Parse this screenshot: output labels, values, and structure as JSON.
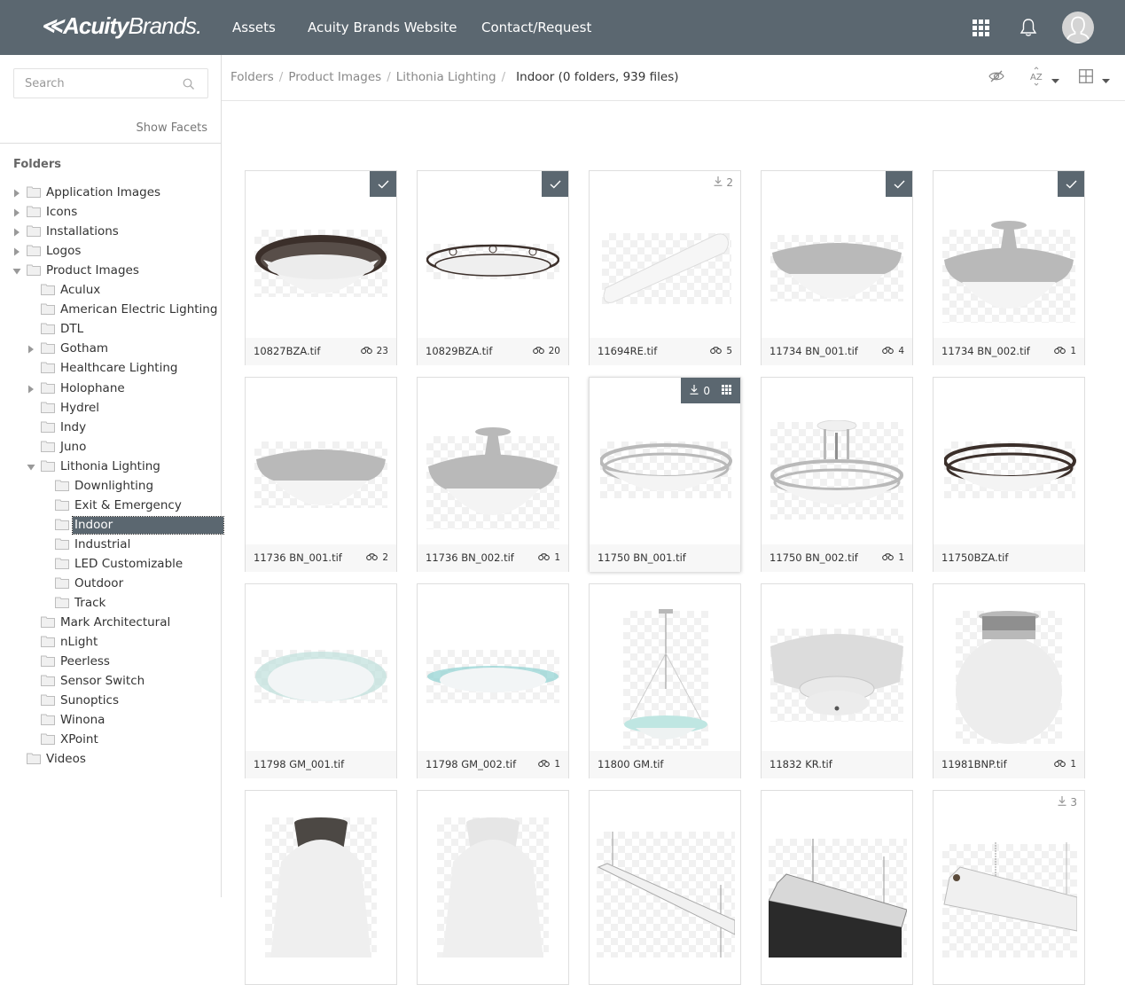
{
  "header": {
    "logo": {
      "mark": "≪",
      "acuity": "Acuity",
      "brands": "Brands."
    },
    "nav": [
      {
        "label": "Assets"
      },
      {
        "label": "Acuity Brands Website"
      },
      {
        "label": "Contact/Request"
      }
    ],
    "icons": [
      "apps-grid-icon",
      "bell-icon",
      "user-avatar-icon"
    ],
    "bg_color": "#5b6770"
  },
  "sidebar": {
    "search_placeholder": "Search",
    "show_facets": "Show Facets",
    "folders_title": "Folders",
    "tree": [
      {
        "label": "Application Images",
        "level": 0,
        "toggle": "collapsed"
      },
      {
        "label": "Icons",
        "level": 0,
        "toggle": "collapsed"
      },
      {
        "label": "Installations",
        "level": 0,
        "toggle": "collapsed"
      },
      {
        "label": "Logos",
        "level": 0,
        "toggle": "collapsed"
      },
      {
        "label": "Product Images",
        "level": 0,
        "toggle": "expanded"
      },
      {
        "label": "Aculux",
        "level": 1,
        "toggle": "none"
      },
      {
        "label": "American Electric Lighting",
        "level": 1,
        "toggle": "none"
      },
      {
        "label": "DTL",
        "level": 1,
        "toggle": "none"
      },
      {
        "label": "Gotham",
        "level": 1,
        "toggle": "collapsed"
      },
      {
        "label": "Healthcare Lighting",
        "level": 1,
        "toggle": "none"
      },
      {
        "label": "Holophane",
        "level": 1,
        "toggle": "collapsed"
      },
      {
        "label": "Hydrel",
        "level": 1,
        "toggle": "none"
      },
      {
        "label": "Indy",
        "level": 1,
        "toggle": "none"
      },
      {
        "label": "Juno",
        "level": 1,
        "toggle": "none"
      },
      {
        "label": "Lithonia Lighting",
        "level": 1,
        "toggle": "expanded"
      },
      {
        "label": "Downlighting",
        "level": 2,
        "toggle": "none"
      },
      {
        "label": "Exit & Emergency",
        "level": 2,
        "toggle": "none"
      },
      {
        "label": "Indoor",
        "level": 2,
        "toggle": "none",
        "selected": true
      },
      {
        "label": "Industrial",
        "level": 2,
        "toggle": "none"
      },
      {
        "label": "LED Customizable",
        "level": 2,
        "toggle": "none"
      },
      {
        "label": "Outdoor",
        "level": 2,
        "toggle": "none"
      },
      {
        "label": "Track",
        "level": 2,
        "toggle": "none"
      },
      {
        "label": "Mark Architectural",
        "level": 1,
        "toggle": "none"
      },
      {
        "label": "nLight",
        "level": 1,
        "toggle": "none"
      },
      {
        "label": "Peerless",
        "level": 1,
        "toggle": "none"
      },
      {
        "label": "Sensor Switch",
        "level": 1,
        "toggle": "none"
      },
      {
        "label": "Sunoptics",
        "level": 1,
        "toggle": "none"
      },
      {
        "label": "Winona",
        "level": 1,
        "toggle": "none"
      },
      {
        "label": "XPoint",
        "level": 1,
        "toggle": "none"
      },
      {
        "label": "Videos",
        "level": 0,
        "toggle": "none"
      }
    ]
  },
  "breadcrumb": {
    "items": [
      "Folders",
      "Product Images",
      "Lithonia Lighting"
    ],
    "separator": "/",
    "current": "Indoor (0 folders, 939 files)"
  },
  "toolbar": {
    "icons": [
      "hide-icon",
      "sort-az-icon",
      "grid-view-icon"
    ]
  },
  "assets": [
    {
      "name": "10827BZA.tif",
      "views": "23",
      "checked": true,
      "thumb": "bronze-scroll-dome"
    },
    {
      "name": "10829BZA.tif",
      "views": "20",
      "checked": true,
      "thumb": "bronze-scroll-flat"
    },
    {
      "name": "11694RE.tif",
      "views": "5",
      "downloads": "2",
      "thumb": "linear-wrap"
    },
    {
      "name": "11734 BN_001.tif",
      "views": "4",
      "checked": true,
      "thumb": "nickel-dome"
    },
    {
      "name": "11734 BN_002.tif",
      "views": "1",
      "checked": true,
      "thumb": "nickel-semi-flush"
    },
    {
      "name": "11736 BN_001.tif",
      "views": "2",
      "thumb": "nickel-dome-slim"
    },
    {
      "name": "11736 BN_002.tif",
      "views": "1",
      "thumb": "nickel-semi-flush"
    },
    {
      "name": "11750 BN_001.tif",
      "hover": true,
      "downloads": "0",
      "thumb": "nickel-band"
    },
    {
      "name": "11750 BN_002.tif",
      "views": "1",
      "thumb": "nickel-band-semi"
    },
    {
      "name": "11750BZA.tif",
      "thumb": "bronze-band"
    },
    {
      "name": "11798 GM_001.tif",
      "thumb": "glass-plate"
    },
    {
      "name": "11798 GM_002.tif",
      "views": "1",
      "thumb": "glass-plate-teal"
    },
    {
      "name": "11800 GM.tif",
      "thumb": "pendant-glass"
    },
    {
      "name": "11832 KR.tif",
      "thumb": "white-drum"
    },
    {
      "name": "11981BNP.tif",
      "views": "1",
      "thumb": "globe-nickel"
    },
    {
      "name": "",
      "thumb": "globe-bronze-tall"
    },
    {
      "name": "",
      "thumb": "globe-white-tall"
    },
    {
      "name": "",
      "thumb": "shop-light"
    },
    {
      "name": "",
      "thumb": "diamond-plate-light"
    },
    {
      "name": "",
      "downloads": "3",
      "thumb": "strip-chain"
    }
  ]
}
